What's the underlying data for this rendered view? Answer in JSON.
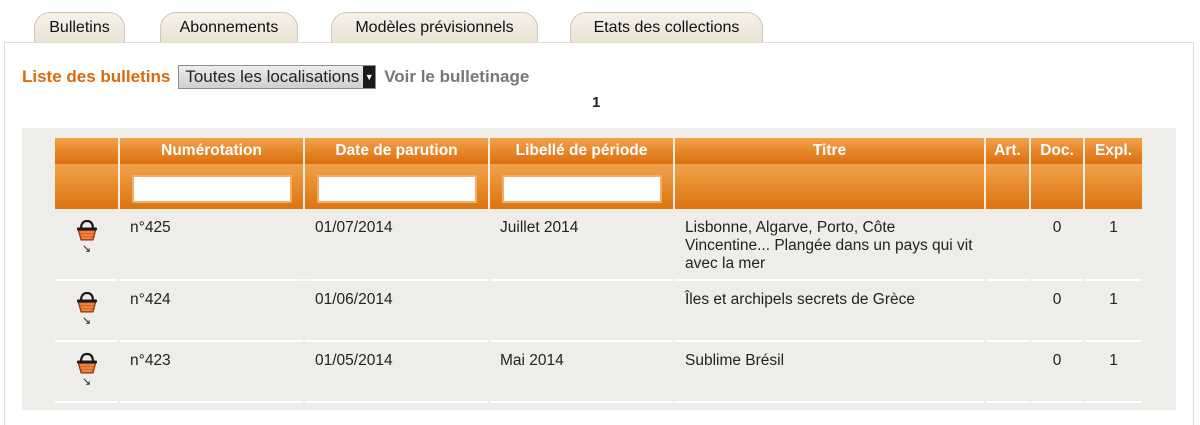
{
  "tabs": [
    "Bulletins",
    "Abonnements",
    "Modèles prévisionnels",
    "Etats des collections"
  ],
  "list_title": "Liste des bulletins",
  "location_select": {
    "selected": "Toutes les localisations"
  },
  "voir_link": "Voir le bulletinage",
  "page_number": "1",
  "columns": [
    "Numérotation",
    "Date de parution",
    "Libellé de période",
    "Titre",
    "Art.",
    "Doc.",
    "Expl."
  ],
  "rows": [
    {
      "num": "n°425",
      "date": "01/07/2014",
      "periode": "Juillet 2014",
      "titre": "Lisbonne, Algarve, Porto, Côte Vincentine... Plangée dans un pays qui vit avec la mer",
      "art": "",
      "doc": "0",
      "expl": "1"
    },
    {
      "num": "n°424",
      "date": "01/06/2014",
      "periode": "",
      "titre": "Îles et archipels secrets de Grèce",
      "art": "",
      "doc": "0",
      "expl": "1"
    },
    {
      "num": "n°423",
      "date": "01/05/2014",
      "periode": "Mai 2014",
      "titre": "Sublime Brésil",
      "art": "",
      "doc": "0",
      "expl": "1"
    }
  ],
  "icons": {
    "row_action": "basket-icon",
    "row_sub": "arrow-down-right-icon"
  },
  "colors": {
    "accent": "#d96a0a",
    "header_orange": "#e27a1c",
    "row_bg": "#efede9"
  }
}
